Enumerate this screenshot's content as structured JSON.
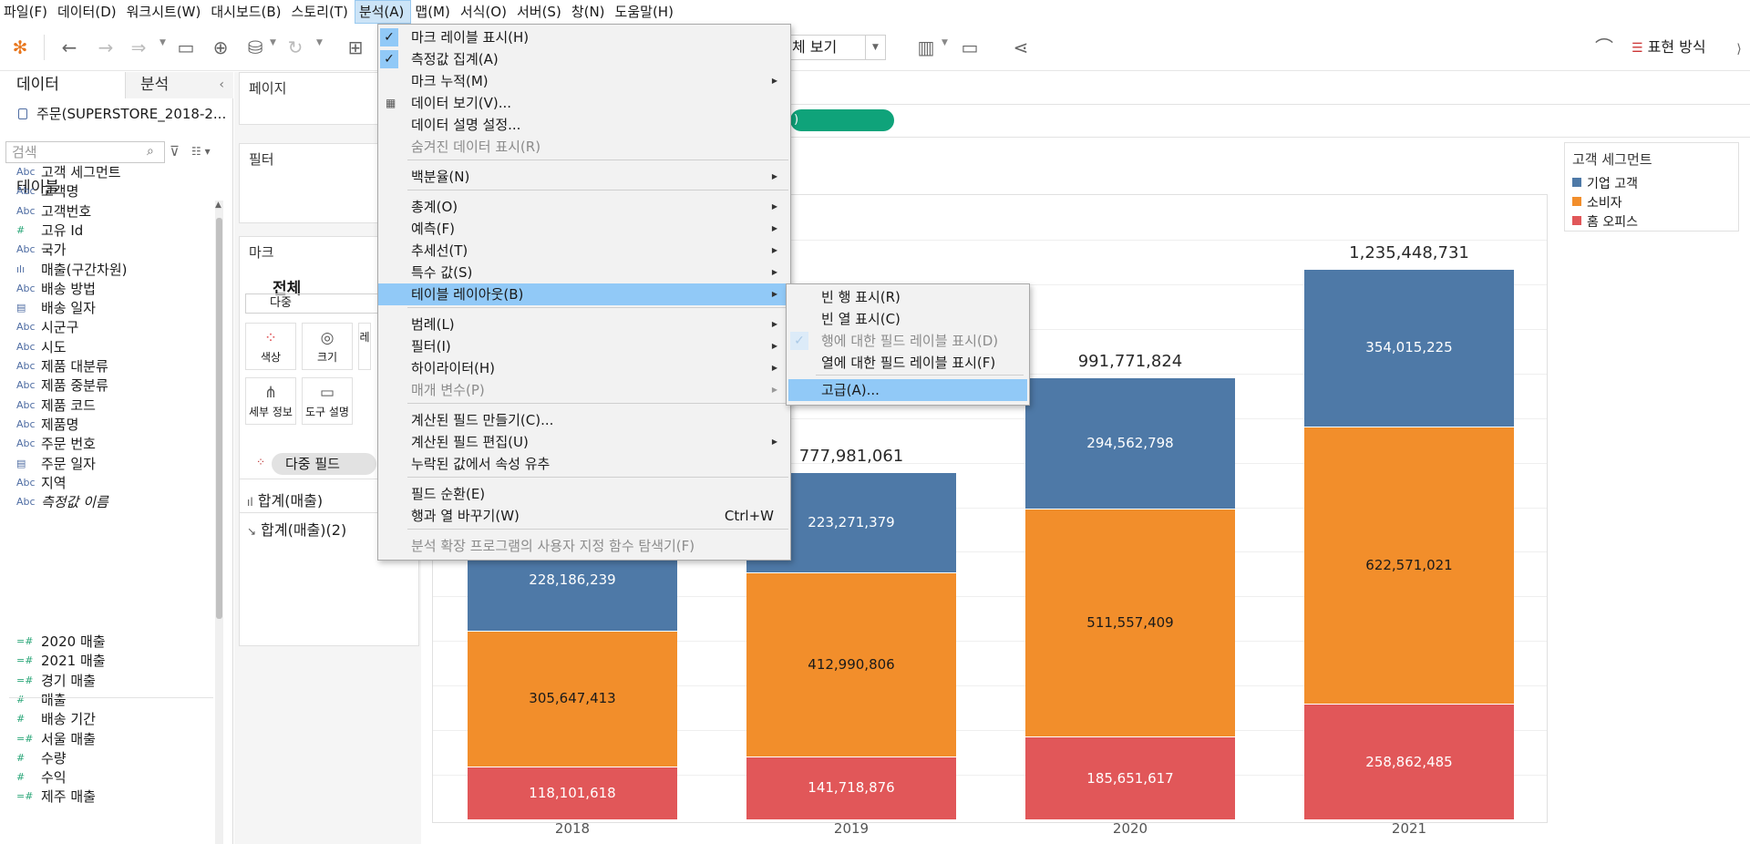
{
  "menubar": {
    "items": [
      "파일(F)",
      "데이터(D)",
      "워크시트(W)",
      "대시보드(B)",
      "스토리(T)",
      "분석(A)",
      "맵(M)",
      "서식(O)",
      "서버(S)",
      "창(N)",
      "도움말(H)"
    ],
    "active_index": 5
  },
  "toolbar": {
    "view_select_value": "체 보기",
    "show_me_label": "표현 방식"
  },
  "data_pane": {
    "tab_data": "데이터",
    "tab_analysis": "분석",
    "datasource": "주문(SUPERSTORE_2018-2...",
    "search_placeholder": "검색",
    "tables_heading": "테이블",
    "fields": [
      {
        "type": "Abc",
        "name": "고객 세그먼트"
      },
      {
        "type": "Abc",
        "name": "고객명"
      },
      {
        "type": "Abc",
        "name": "고객번호"
      },
      {
        "type": "#",
        "name": "고유 Id"
      },
      {
        "type": "Abc",
        "name": "국가"
      },
      {
        "type": "bins",
        "name": "매출(구간차원)"
      },
      {
        "type": "Abc",
        "name": "배송 방법"
      },
      {
        "type": "date",
        "name": "배송 일자"
      },
      {
        "type": "Abc",
        "name": "시군구"
      },
      {
        "type": "Abc",
        "name": "시도"
      },
      {
        "type": "Abc",
        "name": "제품 대분류"
      },
      {
        "type": "Abc",
        "name": "제품 중분류"
      },
      {
        "type": "Abc",
        "name": "제품 코드"
      },
      {
        "type": "Abc",
        "name": "제품명"
      },
      {
        "type": "Abc",
        "name": "주문 번호"
      },
      {
        "type": "date",
        "name": "주문 일자"
      },
      {
        "type": "Abc",
        "name": "지역"
      },
      {
        "type": "Abc",
        "name": "측정값 이름"
      }
    ],
    "measures": [
      {
        "type": "=#",
        "name": "2020 매출"
      },
      {
        "type": "=#",
        "name": "2021 매출"
      },
      {
        "type": "=#",
        "name": "경기 매출"
      },
      {
        "type": "#",
        "name": "매출"
      },
      {
        "type": "#",
        "name": "배송 기간"
      },
      {
        "type": "=#",
        "name": "서울 매출"
      },
      {
        "type": "#",
        "name": "수량"
      },
      {
        "type": "#",
        "name": "수익"
      },
      {
        "type": "=#",
        "name": "제주 매출"
      }
    ]
  },
  "shelves": {
    "pages_title": "페이지",
    "filters_title": "필터",
    "marks_title": "마크",
    "marks_all": "전체",
    "marks_type": "다중",
    "mark_buttons": [
      {
        "icon": "color-icon",
        "label": "색상"
      },
      {
        "icon": "size-icon",
        "label": "크기"
      },
      {
        "icon": "label-icon",
        "label": "레"
      },
      {
        "icon": "detail-icon",
        "label": "세부 정보"
      },
      {
        "icon": "tooltip-icon",
        "label": "도구 설명"
      }
    ],
    "multi_field_pill": "다중 필드",
    "measure_rows": [
      "합계(매출)",
      "합계(매출)(2)"
    ],
    "row_pill_text": ")"
  },
  "legend": {
    "title": "고객 세그먼트",
    "items": [
      {
        "label": "기업 고객",
        "color": "#4e79a7"
      },
      {
        "label": "소비자",
        "color": "#f28e2b"
      },
      {
        "label": "홈 오피스",
        "color": "#e15759"
      }
    ]
  },
  "chart_data": {
    "type": "bar",
    "stacked": true,
    "categories": [
      "2018",
      "2019",
      "2020",
      "2021"
    ],
    "series": [
      {
        "name": "기업 고객",
        "color": "#4e79a7",
        "values": [
          228186239,
          223271379,
          294562798,
          354015225
        ],
        "labels": [
          "228,186,239",
          "223,271,379",
          "294,562,798",
          "354,015,225"
        ]
      },
      {
        "name": "소비자",
        "color": "#f28e2b",
        "values": [
          305647413,
          412990806,
          511557409,
          622571021
        ],
        "labels": [
          "305,647,413",
          "412,990,806",
          "511,557,409",
          "622,571,021"
        ]
      },
      {
        "name": "홈 오피스",
        "color": "#e15759",
        "values": [
          118101618,
          141718876,
          185651617,
          258862485
        ],
        "labels": [
          "118,101,618",
          "141,718,876",
          "185,651,617",
          "258,862,485"
        ]
      }
    ],
    "totals": [
      "777,981,061",
      "991,771,824",
      "1,235,448,731"
    ],
    "ylim": [
      0,
      1400000000
    ]
  },
  "analysis_menu": {
    "items": [
      {
        "label": "마크 레이블 표시(H)",
        "checked": true
      },
      {
        "label": "측정값 집계(A)",
        "checked": true
      },
      {
        "label": "마크 누적(M)",
        "submenu": true
      },
      {
        "label": "데이터 보기(V)...",
        "icon": true
      },
      {
        "label": "데이터 설명 설정..."
      },
      {
        "label": "숨겨진 데이터 표시(R)",
        "disabled": true
      },
      {
        "label": "백분율(N)",
        "submenu": true
      },
      {
        "label": "총계(O)",
        "submenu": true
      },
      {
        "label": "예측(F)",
        "submenu": true
      },
      {
        "label": "추세선(T)",
        "submenu": true
      },
      {
        "label": "특수 값(S)",
        "submenu": true
      },
      {
        "label": "테이블 레이아웃(B)",
        "submenu": true,
        "highlight": true
      },
      {
        "label": "범례(L)",
        "submenu": true
      },
      {
        "label": "필터(I)",
        "submenu": true
      },
      {
        "label": "하이라이터(H)",
        "submenu": true
      },
      {
        "label": "매개 변수(P)",
        "submenu": true,
        "disabled": true
      },
      {
        "label": "계산된 필드 만들기(C)..."
      },
      {
        "label": "계산된 필드 편집(U)",
        "submenu": true
      },
      {
        "label": "누락된 값에서 속성 유추"
      },
      {
        "label": "필드 순환(E)"
      },
      {
        "label": "행과 열 바꾸기(W)",
        "shortcut": "Ctrl+W"
      },
      {
        "label": "분석 확장 프로그램의 사용자 지정 함수 탐색기(F)",
        "disabled": true
      }
    ]
  },
  "table_layout_menu": {
    "items": [
      {
        "label": "빈 행 표시(R)"
      },
      {
        "label": "빈 열 표시(C)"
      },
      {
        "label": "행에 대한 필드 레이블 표시(D)",
        "checked": true,
        "disabled": true
      },
      {
        "label": "열에 대한 필드 레이블 표시(F)"
      },
      {
        "label": "고급(A)...",
        "highlight": true
      }
    ]
  }
}
